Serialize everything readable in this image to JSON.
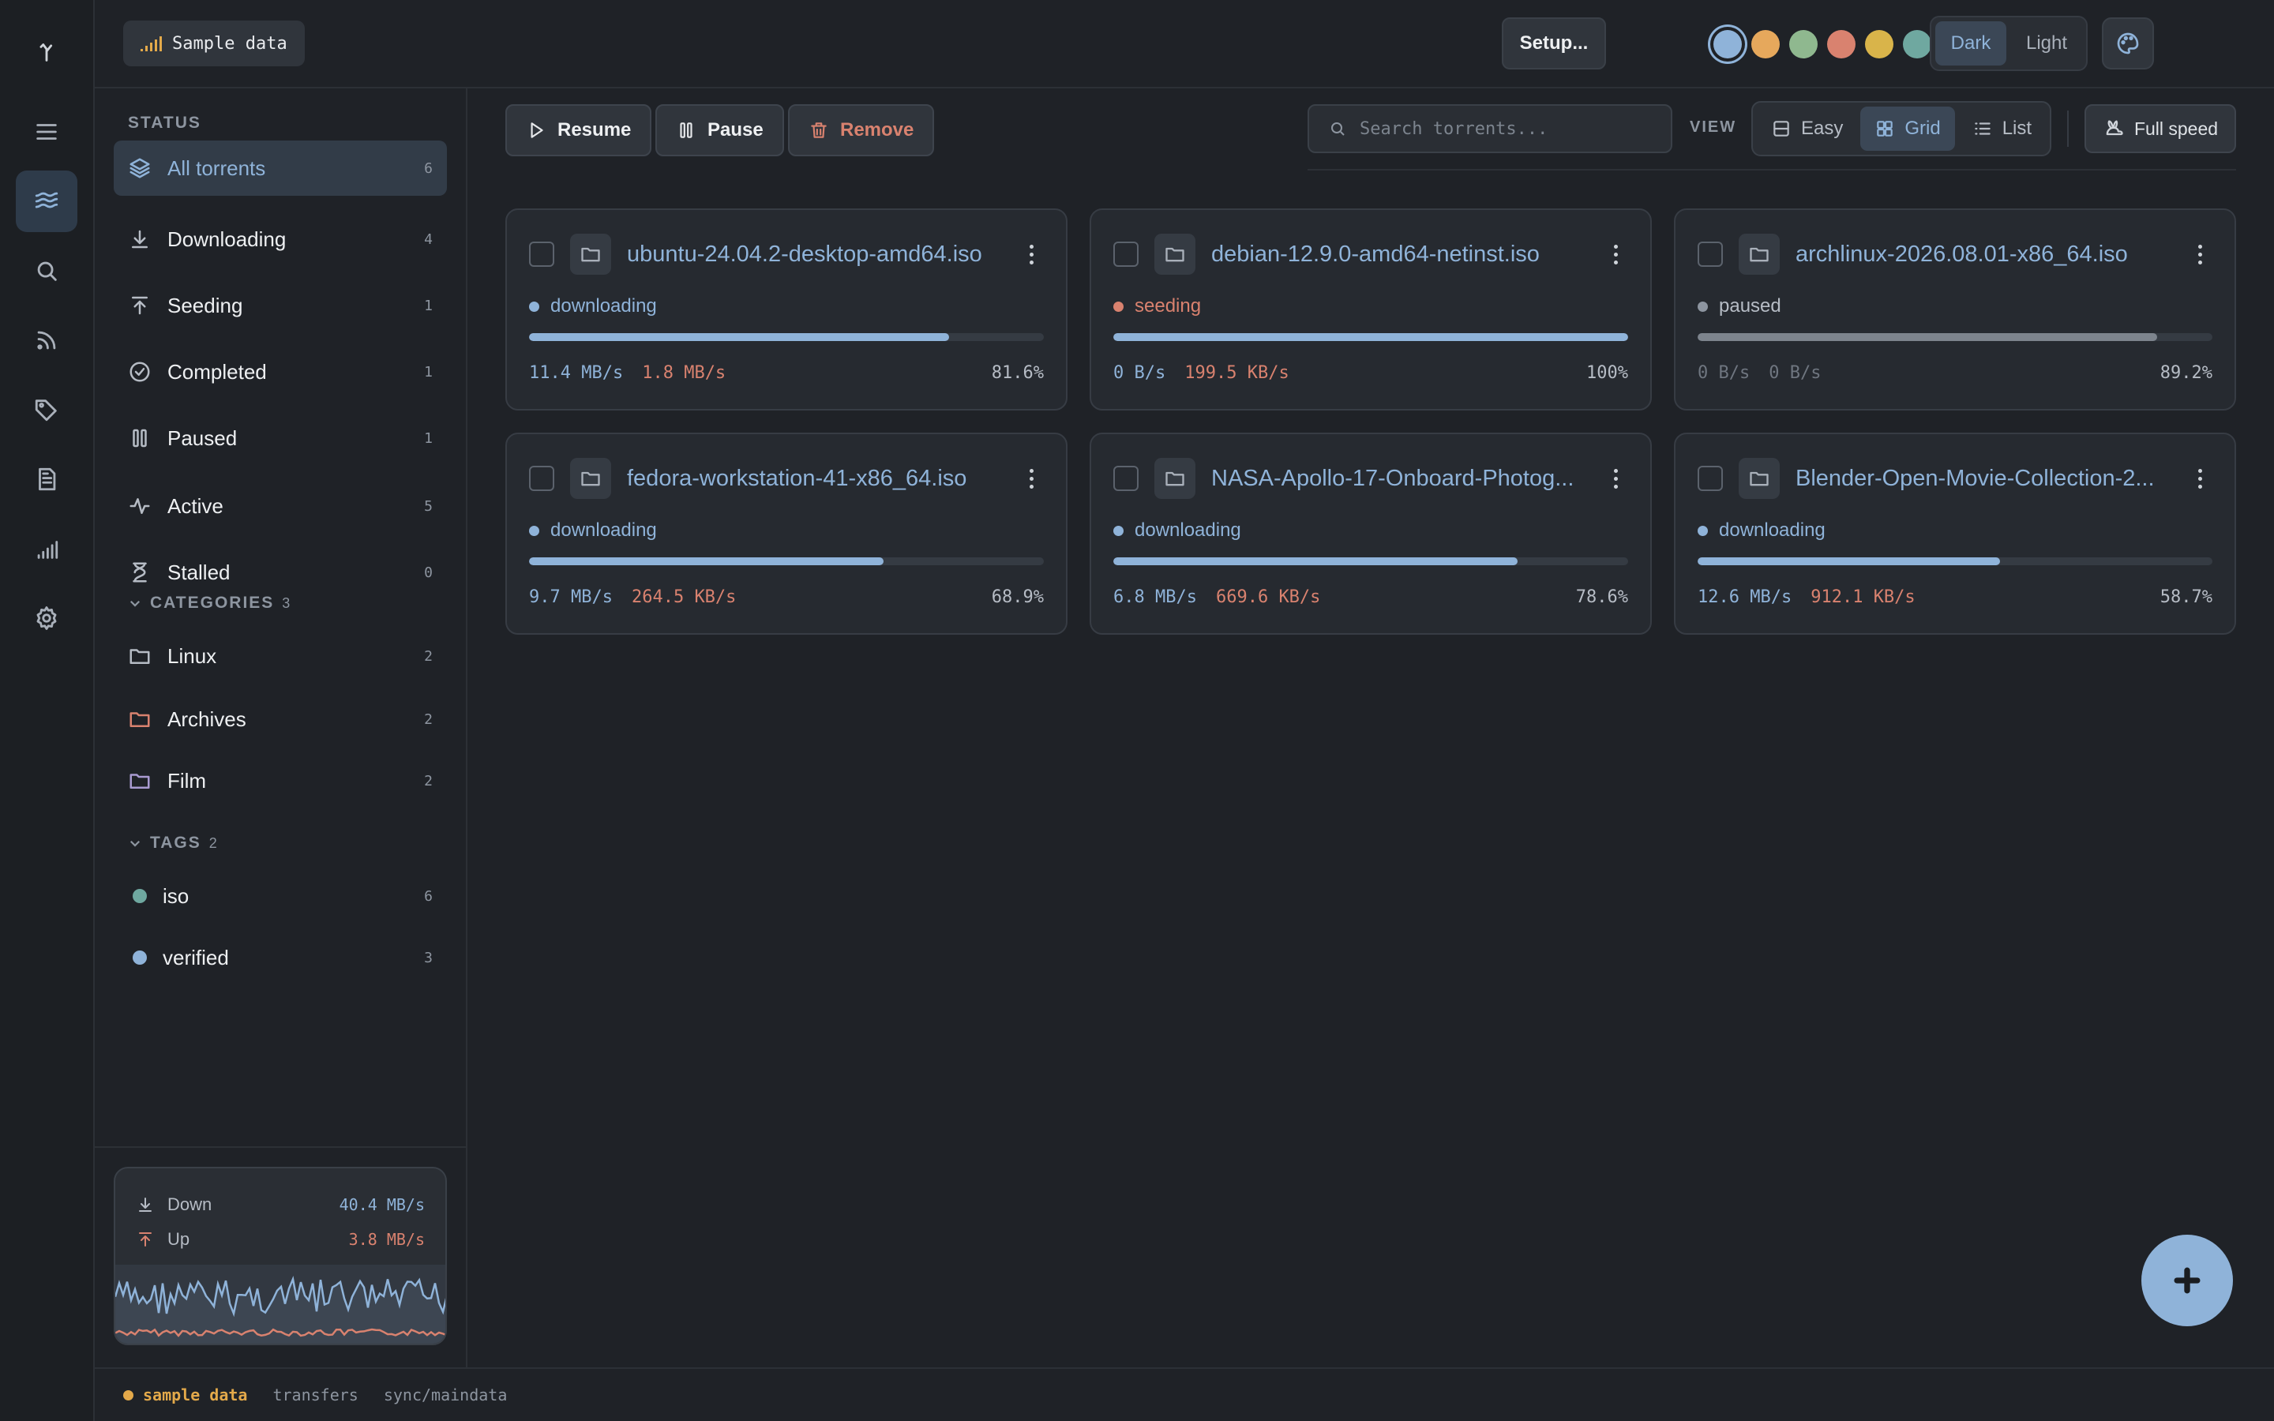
{
  "topbar": {
    "sample_label": "Sample data",
    "setup_label": "Setup...",
    "swatches": [
      "#8fb3d9",
      "#e6a85c",
      "#8fb88f",
      "#d9826f",
      "#d9b44a",
      "#6fa8a0",
      "#a99bd1",
      "#9ca3ad"
    ],
    "mode": {
      "dark": "Dark",
      "light": "Light"
    }
  },
  "sidebar": {
    "status_title": "STATUS",
    "status_items": [
      {
        "label": "All torrents",
        "count": "6",
        "icon": "layers-icon"
      },
      {
        "label": "Downloading",
        "count": "4",
        "icon": "download-icon"
      },
      {
        "label": "Seeding",
        "count": "1",
        "icon": "upload-icon"
      },
      {
        "label": "Completed",
        "count": "1",
        "icon": "check-circle-icon"
      },
      {
        "label": "Paused",
        "count": "1",
        "icon": "pause-icon"
      },
      {
        "label": "Active",
        "count": "5",
        "icon": "activity-icon"
      },
      {
        "label": "Stalled",
        "count": "0",
        "icon": "hourglass-icon"
      }
    ],
    "categories_title": "CATEGORIES",
    "categories_count": "3",
    "categories": [
      {
        "label": "Linux",
        "count": "2",
        "color": "#b6bcc5"
      },
      {
        "label": "Archives",
        "count": "2",
        "color": "#d9826f"
      },
      {
        "label": "Film",
        "count": "2",
        "color": "#a99bd1"
      }
    ],
    "tags_title": "TAGS",
    "tags_count": "2",
    "tags": [
      {
        "label": "iso",
        "count": "6",
        "color": "#6fa8a0"
      },
      {
        "label": "verified",
        "count": "3",
        "color": "#8fb3d9"
      }
    ],
    "speed": {
      "down_label": "Down",
      "down_value": "40.4 MB/s",
      "up_label": "Up",
      "up_value": "3.8 MB/s",
      "down_color": "#8fb3d9",
      "up_color": "#d9826f"
    }
  },
  "toolbar": {
    "resume": "Resume",
    "pause": "Pause",
    "remove": "Remove",
    "search_placeholder": "Search torrents...",
    "view_label": "VIEW",
    "views": [
      "Easy",
      "Grid",
      "List"
    ],
    "active_view": "Grid",
    "full_speed": "Full speed"
  },
  "torrents": [
    {
      "name": "ubuntu-24.04.2-desktop-amd64.iso",
      "status": "downloading",
      "progress": 0.816,
      "down": "11.4 MB/s",
      "up": "1.8 MB/s",
      "pct": "81.6%"
    },
    {
      "name": "debian-12.9.0-amd64-netinst.iso",
      "status": "seeding",
      "progress": 1.0,
      "down": "0 B/s",
      "up": "199.5 KB/s",
      "pct": "100%"
    },
    {
      "name": "archlinux-2026.08.01-x86_64.iso",
      "status": "paused",
      "progress": 0.892,
      "down": "0 B/s",
      "up": "0 B/s",
      "pct": "89.2%"
    },
    {
      "name": "fedora-workstation-41-x86_64.iso",
      "status": "downloading",
      "progress": 0.689,
      "down": "9.7 MB/s",
      "up": "264.5 KB/s",
      "pct": "68.9%"
    },
    {
      "name": "NASA-Apollo-17-Onboard-Photog...",
      "status": "downloading",
      "progress": 0.786,
      "down": "6.8 MB/s",
      "up": "669.6 KB/s",
      "pct": "78.6%"
    },
    {
      "name": "Blender-Open-Movie-Collection-2...",
      "status": "downloading",
      "progress": 0.587,
      "down": "12.6 MB/s",
      "up": "912.1 KB/s",
      "pct": "58.7%"
    }
  ],
  "status_colors": {
    "downloading": "#8fb3d9",
    "seeding": "#d9826f",
    "paused": "#8d95a0"
  },
  "statusbar": {
    "sample": "sample data",
    "item1": "transfers",
    "item2": "sync/maindata"
  }
}
